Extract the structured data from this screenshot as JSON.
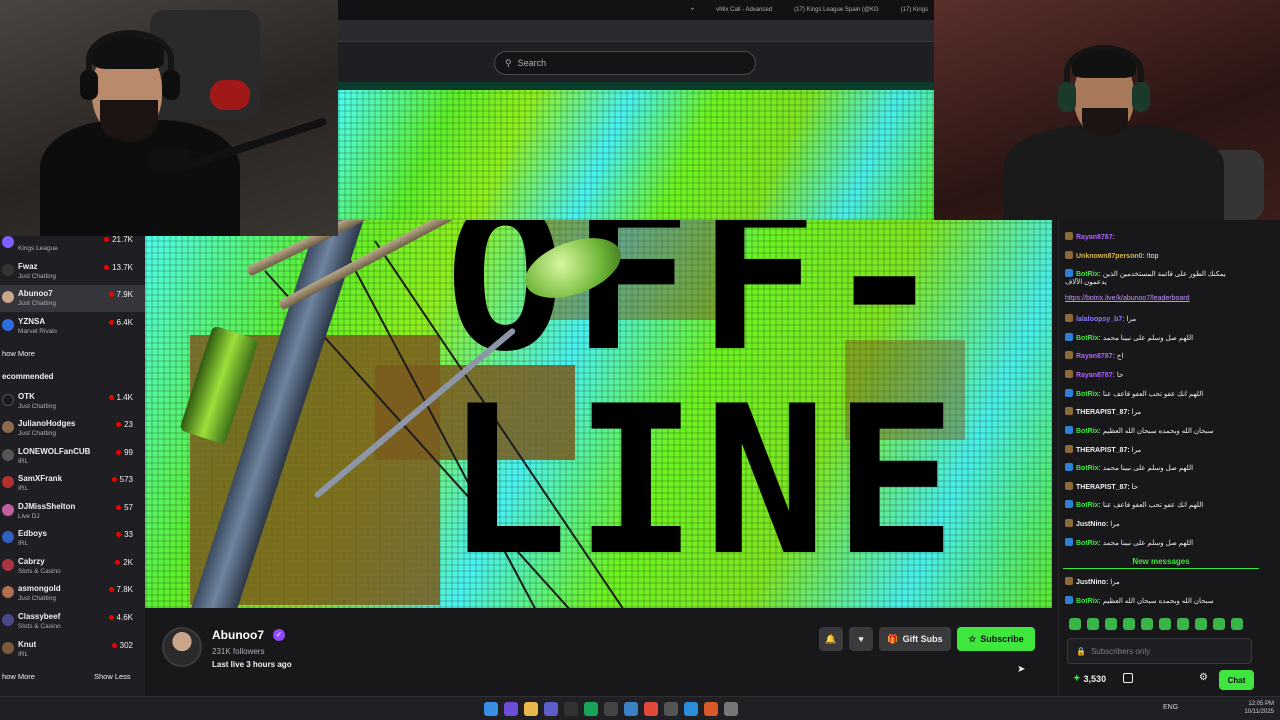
{
  "browser": {
    "tabs": [
      "+",
      "vMix Call - Advanced",
      "(17) Kings League Spain (@KG",
      "(17) Kings"
    ],
    "search_placeholder": "Search"
  },
  "offline_banner": {
    "line1": "OFF-",
    "line2": "LINE"
  },
  "sidebar": {
    "items": [
      {
        "name": "",
        "category": "Kings League",
        "count": "21.7K",
        "avatar_color": "#7d5fff",
        "active": false
      },
      {
        "name": "Fwaz",
        "category": "Just Chatting",
        "count": "13.7K",
        "avatar_color": "#333333",
        "active": false
      },
      {
        "name": "Abunoo7",
        "category": "Just Chatting",
        "count": "7.9K",
        "avatar_color": "#c9a58a",
        "active": true
      },
      {
        "name": "YZNSA",
        "category": "Marvel Rivals",
        "count": "6.4K",
        "avatar_color": "#2d6cdf",
        "active": false
      }
    ],
    "show_more_1": "how More",
    "recommended_heading": "ecommended",
    "recommended": [
      {
        "name": "OTK",
        "category": "Just Chatting",
        "count": "1.4K",
        "avatar_color": "#1a1a1a"
      },
      {
        "name": "JulianoHodges",
        "category": "Just Chatting",
        "count": "23",
        "avatar_color": "#8a6a4a"
      },
      {
        "name": "LONEWOLFanCUB",
        "category": "IRL",
        "count": "99",
        "avatar_color": "#555555"
      },
      {
        "name": "SamXFrank",
        "category": "IRL",
        "count": "573",
        "avatar_color": "#b03030"
      },
      {
        "name": "DJMissShelton",
        "category": "Live DJ",
        "count": "57",
        "avatar_color": "#c060a0"
      },
      {
        "name": "Edboys",
        "category": "IRL",
        "count": "33",
        "avatar_color": "#3060c0"
      },
      {
        "name": "Cabrzy",
        "category": "Slots & Casino",
        "count": "2K",
        "avatar_color": "#aa3344"
      },
      {
        "name": "asmongold",
        "category": "Just Chatting",
        "count": "7.8K",
        "avatar_color": "#b07050"
      },
      {
        "name": "Classybeef",
        "category": "Slots & Casino",
        "count": "4.6K",
        "avatar_color": "#4a4a8a"
      },
      {
        "name": "Knut",
        "category": "IRL",
        "count": "302",
        "avatar_color": "#7a5a3a"
      }
    ],
    "show_more_2": "how More",
    "show_less": "Show Less"
  },
  "channel": {
    "name": "Abunoo7",
    "followers": "231K followers",
    "last_live": "Last live 3 hours ago",
    "gift_subs": "Gift Subs",
    "subscribe": "Subscribe"
  },
  "chat": {
    "messages": [
      {
        "user": "Rayan8787:",
        "text": "",
        "color": "#b062ff"
      },
      {
        "user": "Unknown87person0:",
        "text": "!top",
        "color": "#d9b84a"
      },
      {
        "user": "BotRix:",
        "text": "يمكنك الطور على قائمة المستخدمين الذين",
        "color": "#3ee63e"
      },
      {
        "user": "",
        "text": "يدعمون الآلاف",
        "color": "#efeff1"
      },
      {
        "user": "lalaloopsy_b7:",
        "text": "مرا",
        "color": "#8a7aff"
      },
      {
        "user": "BotRix:",
        "text": "اللهم صل وسلم على نبينا محمد",
        "color": "#3ee63e"
      },
      {
        "user": "Rayan8787:",
        "text": "اخ",
        "color": "#b062ff"
      },
      {
        "user": "Rayan8787:",
        "text": "حا",
        "color": "#b062ff"
      },
      {
        "user": "BotRix:",
        "text": "اللهم انك عفو تحب العفو فاعف عنا",
        "color": "#3ee63e"
      },
      {
        "user": "THERAPIST_87:",
        "text": "مرا",
        "color": "#efeff1"
      },
      {
        "user": "BotRix:",
        "text": "سبحان الله وبحمده سبحان الله العظيم",
        "color": "#3ee63e"
      },
      {
        "user": "THERAPIST_87:",
        "text": "مرا",
        "color": "#efeff1"
      },
      {
        "user": "BotRix:",
        "text": "اللهم صل وسلم على نبينا محمد",
        "color": "#3ee63e"
      },
      {
        "user": "THERAPIST_87:",
        "text": "حا",
        "color": "#efeff1"
      },
      {
        "user": "BotRix:",
        "text": "اللهم انك عفو تحب العفو فاعف عنا",
        "color": "#3ee63e"
      },
      {
        "user": "JustNino:",
        "text": "مرا",
        "color": "#efeff1"
      },
      {
        "user": "BotRix:",
        "text": "اللهم صل وسلم على نبينا محمد",
        "color": "#3ee63e"
      }
    ],
    "leaderboard_link": "https://botrix.live/k/abunoo7/leaderboard",
    "new_messages": "New messages",
    "after_messages": [
      {
        "user": "JustNino:",
        "text": "مرا",
        "color": "#efeff1"
      },
      {
        "user": "BotRix:",
        "text": "سبحان الله وبحمده سبحان الله العظيم",
        "color": "#3ee63e"
      }
    ],
    "input_placeholder": "Subscribers only",
    "points": "3,530",
    "send_label": "Chat"
  },
  "taskbar": {
    "lang": "ENG",
    "time": "12:05 PM",
    "date": "10/11/2025"
  }
}
